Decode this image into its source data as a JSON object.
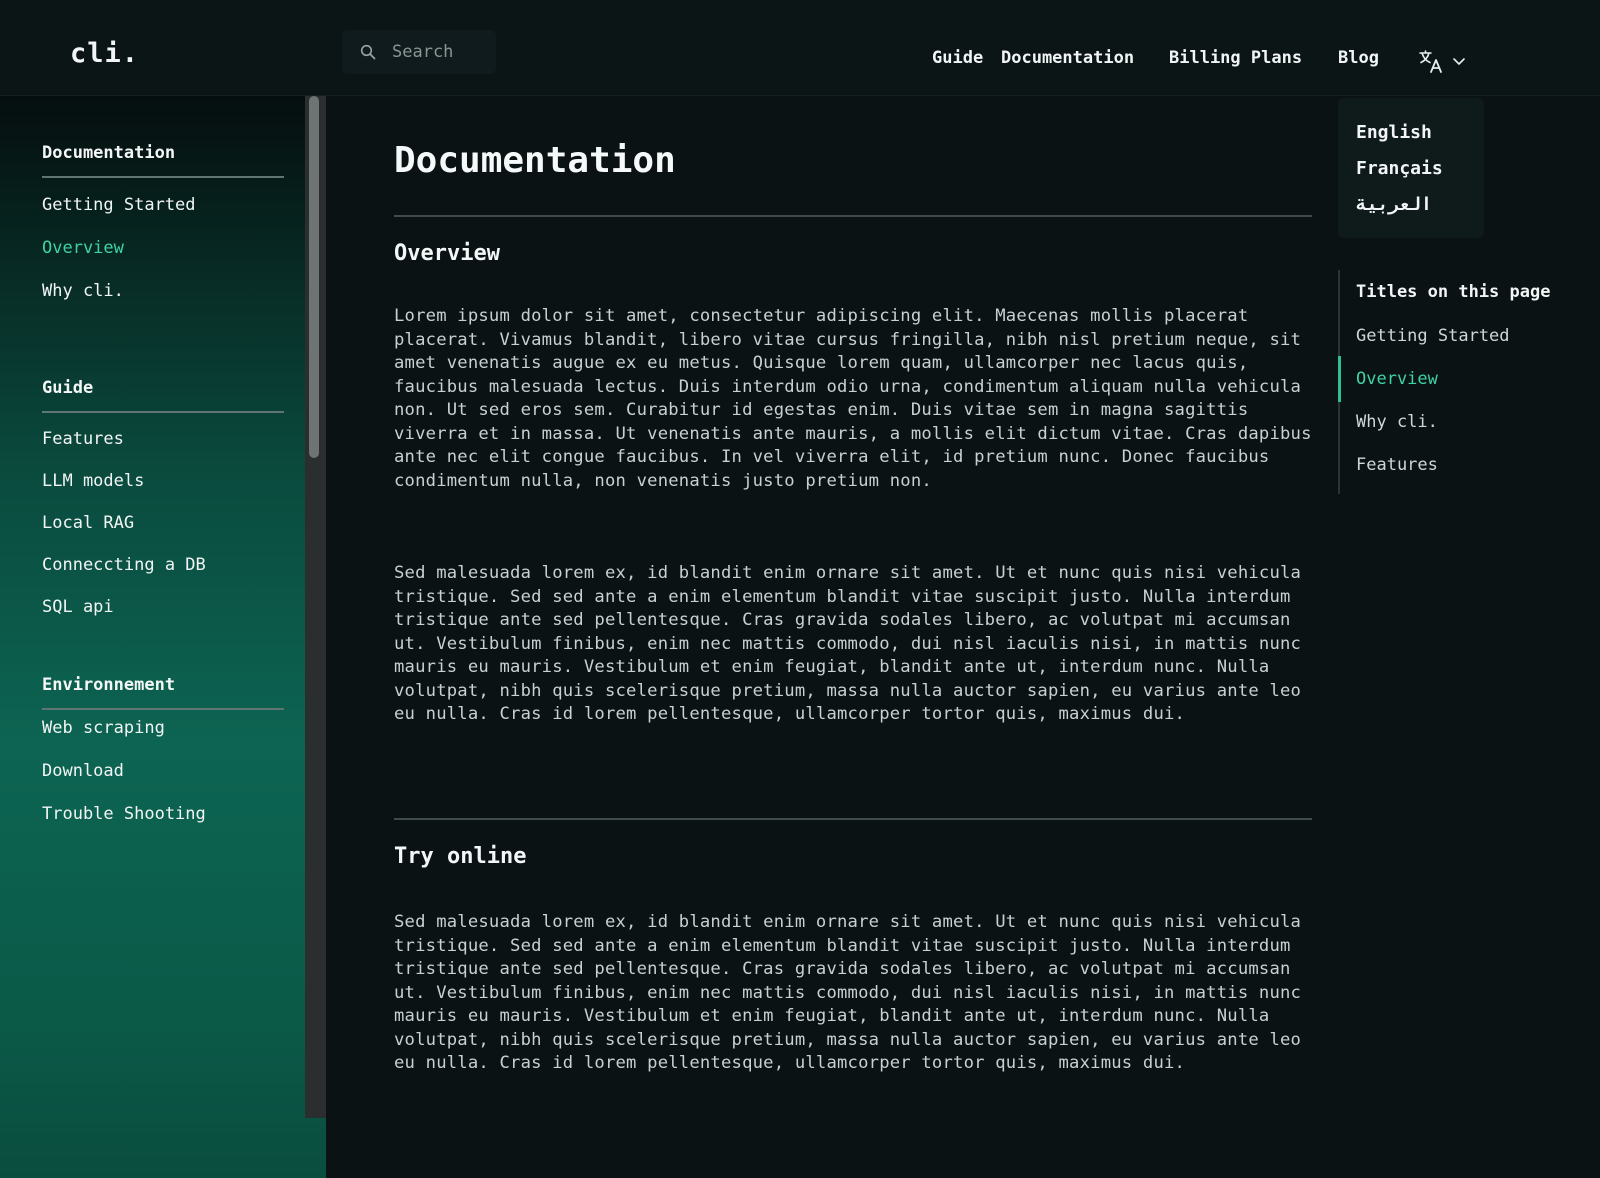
{
  "header": {
    "logo": "cli.",
    "search_placeholder": "Search",
    "nav": [
      "Guide",
      "Documentation",
      "Billing Plans",
      "Blog"
    ]
  },
  "language_menu": {
    "options": [
      "English",
      "Français",
      "العربية"
    ]
  },
  "sidebar": {
    "sections": [
      {
        "title": "Documentation",
        "items": [
          "Getting Started",
          "Overview",
          "Why cli."
        ]
      },
      {
        "title": "Guide",
        "items": [
          "Features",
          "LLM models",
          "Local RAG",
          "Conneccting a DB",
          "SQL api"
        ]
      },
      {
        "title": "Environnement",
        "items": [
          "Web scraping",
          "Download",
          "Trouble Shooting"
        ]
      }
    ],
    "active_item": "Overview"
  },
  "main": {
    "title": "Documentation",
    "sections": [
      {
        "heading": "Overview",
        "paragraphs": [
          "Lorem ipsum dolor sit amet, consectetur adipiscing elit. Maecenas mollis placerat placerat. Vivamus blandit, libero vitae cursus fringilla, nibh nisl pretium neque, sit amet venenatis augue ex eu metus. Quisque lorem quam, ullamcorper nec lacus quis, faucibus malesuada lectus. Duis interdum odio urna, condimentum aliquam nulla vehicula non. Ut sed eros sem. Curabitur id egestas enim. Duis vitae sem in magna sagittis viverra et in massa. Ut venenatis ante mauris, a mollis elit dictum vitae. Cras dapibus ante nec elit congue faucibus. In vel viverra elit, id pretium nunc. Donec faucibus condimentum nulla, non venenatis justo pretium non.",
          "Sed malesuada lorem ex, id blandit enim ornare sit amet. Ut et nunc quis nisi vehicula tristique. Sed sed ante a enim elementum blandit vitae suscipit justo. Nulla interdum tristique ante sed pellentesque. Cras gravida sodales libero, ac volutpat mi accumsan ut. Vestibulum finibus, enim nec mattis commodo, dui nisl iaculis nisi, in mattis nunc mauris eu mauris. Vestibulum et enim feugiat, blandit ante ut, interdum nunc. Nulla volutpat, nibh quis scelerisque pretium, massa nulla auctor sapien, eu varius ante leo eu nulla. Cras id lorem pellentesque, ullamcorper tortor quis, maximus dui."
        ]
      },
      {
        "heading": "Try online",
        "paragraphs": [
          "Sed malesuada lorem ex, id blandit enim ornare sit amet. Ut et nunc quis nisi vehicula tristique. Sed sed ante a enim elementum blandit vitae suscipit justo. Nulla interdum tristique ante sed pellentesque. Cras gravida sodales libero, ac volutpat mi accumsan ut. Vestibulum finibus, enim nec mattis commodo, dui nisl iaculis nisi, in mattis nunc mauris eu mauris. Vestibulum et enim feugiat, blandit ante ut, interdum nunc. Nulla volutpat, nibh quis scelerisque pretium, massa nulla auctor sapien, eu varius ante leo eu nulla. Cras id lorem pellentesque, ullamcorper tortor quis, maximus dui."
        ]
      }
    ]
  },
  "toc": {
    "title": "Titles on this page",
    "items": [
      "Getting Started",
      "Overview",
      "Why cli.",
      "Features"
    ],
    "active_item": "Overview"
  },
  "colors": {
    "accent": "#3fd3a3",
    "background": "#0a1214",
    "sidebar_gradient_mid": "#0d6452"
  },
  "icons": {
    "search": "search-icon",
    "language": "translate-icon",
    "dropdown": "chevron-down-icon"
  }
}
